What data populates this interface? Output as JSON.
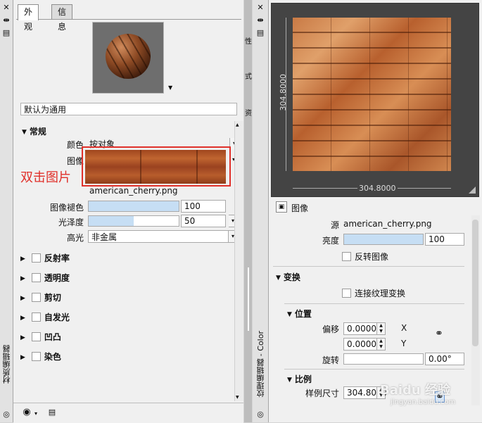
{
  "left_panel": {
    "vertical_title": "材质编辑器",
    "tabs": [
      "外观",
      "信息"
    ],
    "material_name": "默认为通用",
    "section_general": "常规",
    "color_label": "颜色",
    "color_value": "按对象",
    "image_label": "图像",
    "image_file": "american_cherry.png",
    "annotation": "双击图片",
    "image_fade_label": "图像褪色",
    "image_fade_value": "100",
    "image_fade_level": 1.0,
    "glossiness_label": "光泽度",
    "glossiness_value": "50",
    "glossiness_level": 0.5,
    "highlight_label": "高光",
    "highlight_value": "非金属",
    "sections": [
      "反射率",
      "透明度",
      "剪切",
      "自发光",
      "凹凸",
      "染色"
    ]
  },
  "middle_strip": {
    "labels": [
      "性",
      "式",
      "资"
    ]
  },
  "right_panel": {
    "vertical_title": "纹理编辑器 - Color",
    "preview_width": "304.8000",
    "preview_height": "304.8000",
    "image_section": "图像",
    "source_label": "源",
    "source_value": "american_cherry.png",
    "brightness_label": "亮度",
    "brightness_value": "100",
    "invert_label": "反转图像",
    "transform_section": "变换",
    "link_transform_label": "连接纹理变换",
    "position_section": "位置",
    "offset_label": "偏移",
    "offset_x": "0.0000",
    "offset_y": "0.0000",
    "x_label": "X",
    "y_label": "Y",
    "rotation_label": "旋转",
    "rotation_value": "0.00°",
    "scale_section": "比例",
    "sample_size_label": "样例尺寸",
    "sample_size_value": "304.8000"
  },
  "watermark": {
    "text": "Baidu 经验",
    "url": "jingyan.baidu.com"
  }
}
